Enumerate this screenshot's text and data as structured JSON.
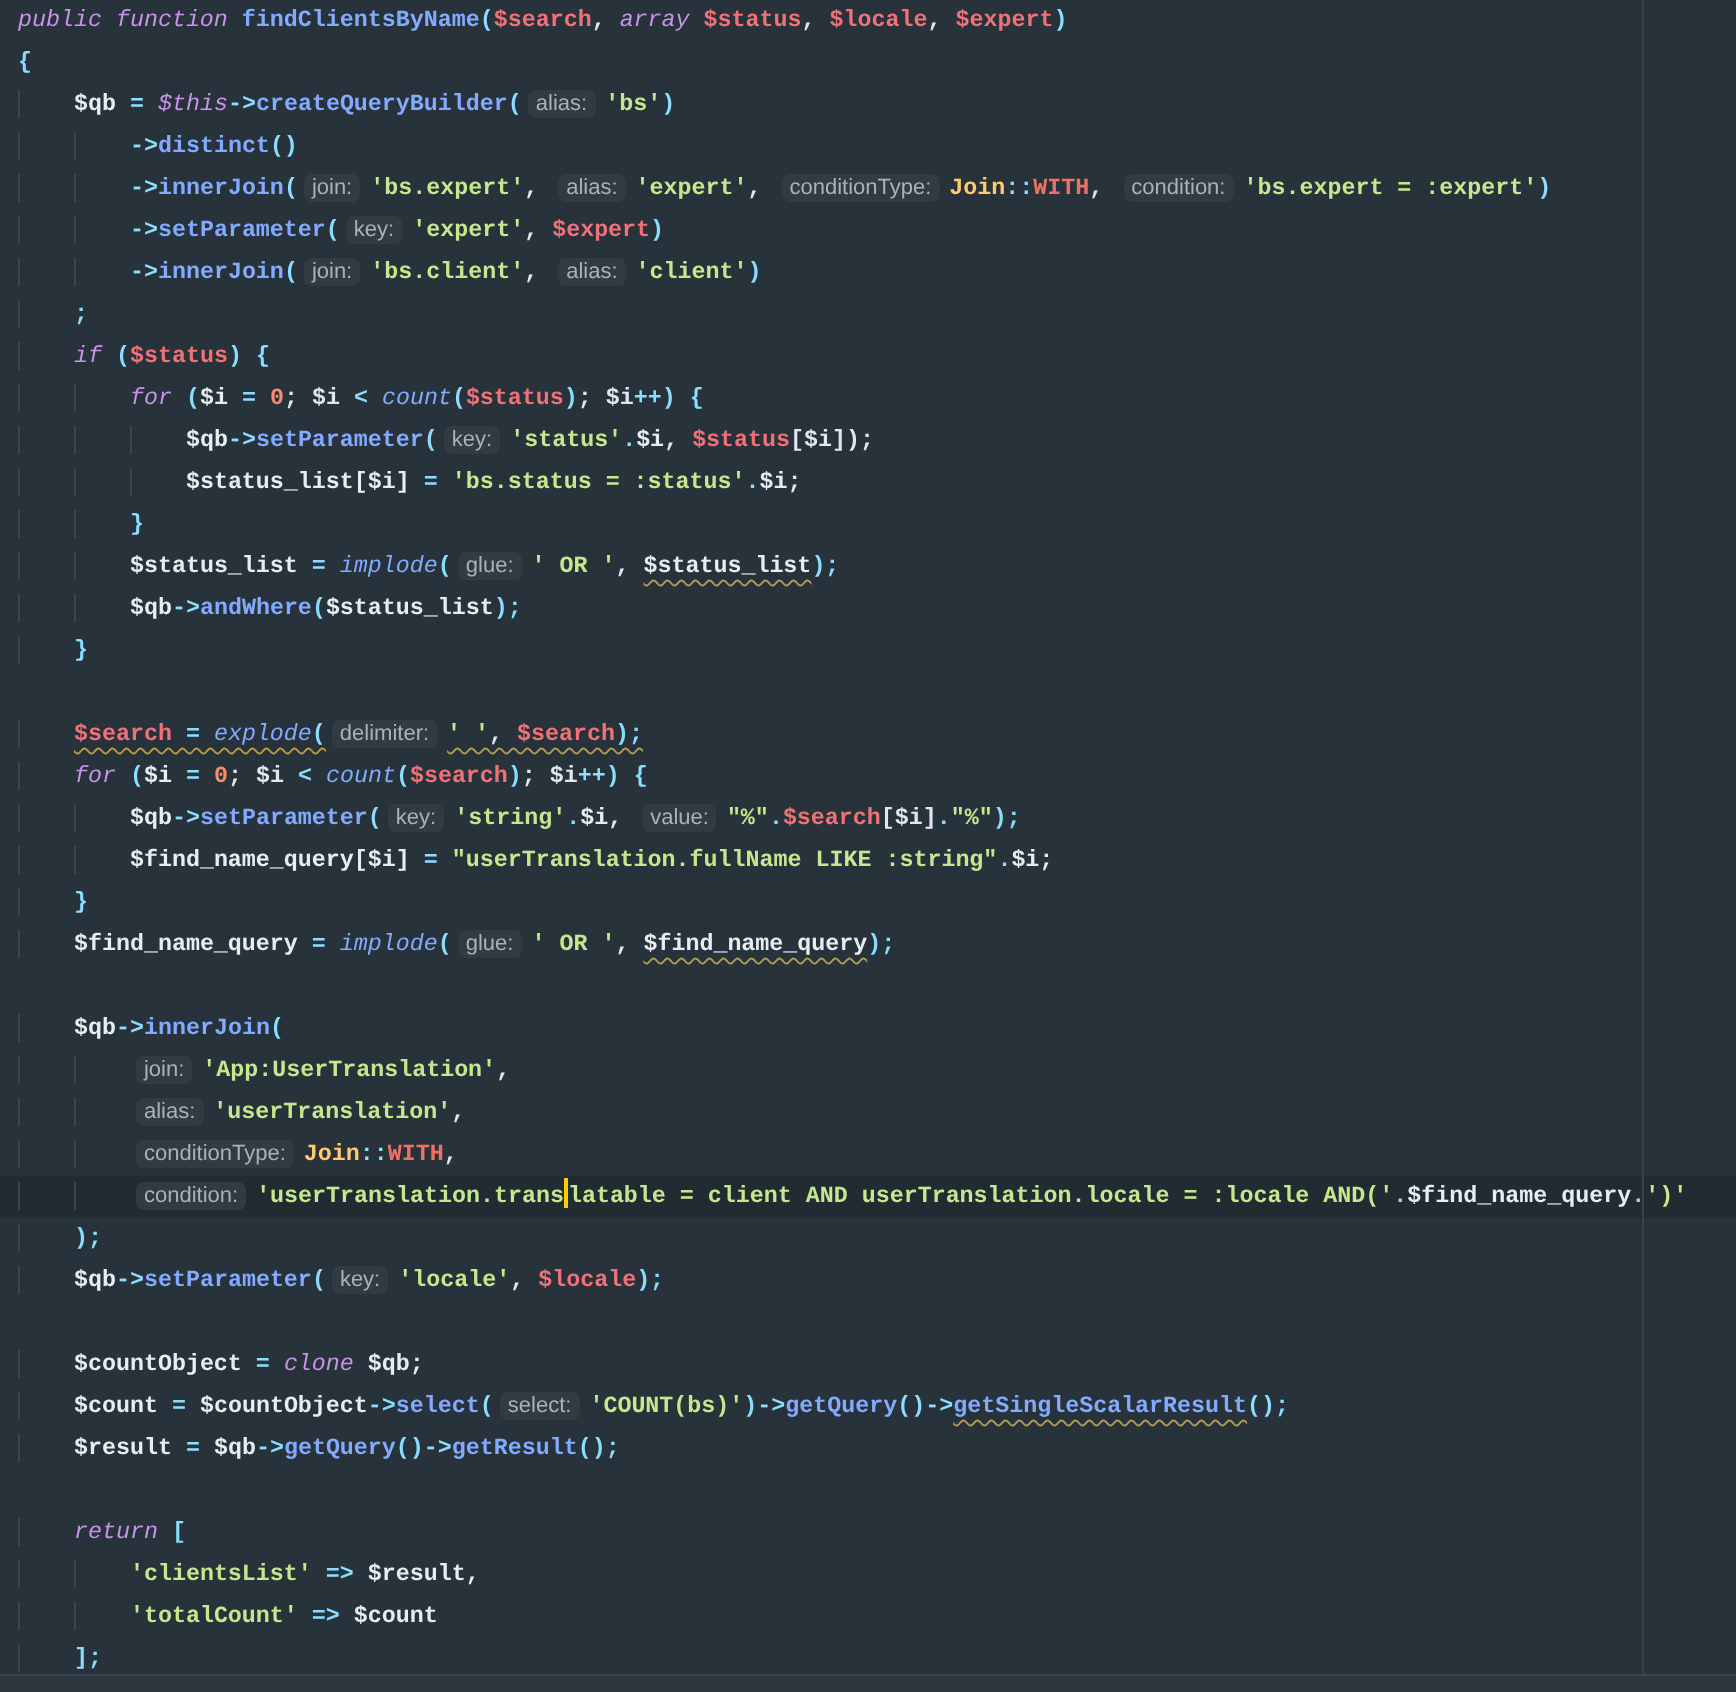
{
  "editor": {
    "lines": [
      {
        "kind": "code",
        "tokens": [
          {
            "kind": "kw",
            "text": "public function "
          },
          {
            "kind": "fn",
            "text": "findClientsByName"
          },
          {
            "kind": "punc",
            "text": "("
          },
          {
            "kind": "param",
            "text": "$search"
          },
          {
            "kind": "plain",
            "text": ", "
          },
          {
            "kind": "kw",
            "text": "array "
          },
          {
            "kind": "param",
            "text": "$status"
          },
          {
            "kind": "plain",
            "text": ", "
          },
          {
            "kind": "param",
            "text": "$locale"
          },
          {
            "kind": "plain",
            "text": ", "
          },
          {
            "kind": "param",
            "text": "$expert"
          },
          {
            "kind": "punc",
            "text": ")"
          }
        ]
      },
      {
        "kind": "code",
        "tokens": [
          {
            "kind": "punc",
            "text": "{"
          }
        ]
      },
      {
        "kind": "code",
        "tokens": [
          {
            "kind": "var",
            "text": "    $qb"
          },
          {
            "kind": "op",
            "text": " = "
          },
          {
            "kind": "kw",
            "text": "$this"
          },
          {
            "kind": "op",
            "text": "->"
          },
          {
            "kind": "fn",
            "text": "createQueryBuilder"
          },
          {
            "kind": "punc",
            "text": "("
          },
          {
            "kind": "hint",
            "text": "alias:"
          },
          {
            "kind": "str",
            "text": "'bs'"
          },
          {
            "kind": "punc",
            "text": ")"
          }
        ]
      },
      {
        "kind": "code",
        "tokens": [
          {
            "kind": "op",
            "text": "        ->"
          },
          {
            "kind": "fn",
            "text": "distinct"
          },
          {
            "kind": "punc",
            "text": "()"
          }
        ]
      },
      {
        "kind": "code",
        "tokens": [
          {
            "kind": "op",
            "text": "        ->"
          },
          {
            "kind": "fn",
            "text": "innerJoin"
          },
          {
            "kind": "punc",
            "text": "("
          },
          {
            "kind": "hint",
            "text": "join:"
          },
          {
            "kind": "str",
            "text": "'bs.expert'"
          },
          {
            "kind": "plain",
            "text": ", "
          },
          {
            "kind": "hint",
            "text": "alias:"
          },
          {
            "kind": "str",
            "text": "'expert'"
          },
          {
            "kind": "plain",
            "text": ", "
          },
          {
            "kind": "hint",
            "text": "conditionType:"
          },
          {
            "kind": "cls",
            "text": "Join"
          },
          {
            "kind": "op",
            "text": "::"
          },
          {
            "kind": "const",
            "text": "WITH"
          },
          {
            "kind": "plain",
            "text": ", "
          },
          {
            "kind": "hint",
            "text": "condition:"
          },
          {
            "kind": "str",
            "text": "'bs.expert = :expert'"
          },
          {
            "kind": "punc",
            "text": ")"
          }
        ]
      },
      {
        "kind": "code",
        "tokens": [
          {
            "kind": "op",
            "text": "        ->"
          },
          {
            "kind": "fn",
            "text": "setParameter"
          },
          {
            "kind": "punc",
            "text": "("
          },
          {
            "kind": "hint",
            "text": "key:"
          },
          {
            "kind": "str",
            "text": "'expert'"
          },
          {
            "kind": "plain",
            "text": ", "
          },
          {
            "kind": "param",
            "text": "$expert"
          },
          {
            "kind": "punc",
            "text": ")"
          }
        ]
      },
      {
        "kind": "code",
        "tokens": [
          {
            "kind": "op",
            "text": "        ->"
          },
          {
            "kind": "fn",
            "text": "innerJoin"
          },
          {
            "kind": "punc",
            "text": "("
          },
          {
            "kind": "hint",
            "text": "join:"
          },
          {
            "kind": "str",
            "text": "'bs.client'"
          },
          {
            "kind": "plain",
            "text": ", "
          },
          {
            "kind": "hint",
            "text": "alias:"
          },
          {
            "kind": "str",
            "text": "'client'"
          },
          {
            "kind": "punc",
            "text": ")"
          }
        ]
      },
      {
        "kind": "code",
        "tokens": [
          {
            "kind": "punc",
            "text": "    ;"
          }
        ]
      },
      {
        "kind": "code",
        "tokens": [
          {
            "kind": "kw",
            "text": "    if"
          },
          {
            "kind": "punc",
            "text": " ("
          },
          {
            "kind": "param",
            "text": "$status"
          },
          {
            "kind": "punc",
            "text": ") {"
          }
        ]
      },
      {
        "kind": "code",
        "tokens": [
          {
            "kind": "kw",
            "text": "        for"
          },
          {
            "kind": "punc",
            "text": " ("
          },
          {
            "kind": "var",
            "text": "$i"
          },
          {
            "kind": "op",
            "text": " = "
          },
          {
            "kind": "num",
            "text": "0"
          },
          {
            "kind": "plain",
            "text": "; $i"
          },
          {
            "kind": "op",
            "text": " < "
          },
          {
            "kind": "builtin",
            "text": "count"
          },
          {
            "kind": "punc",
            "text": "("
          },
          {
            "kind": "param",
            "text": "$status"
          },
          {
            "kind": "punc",
            "text": ")"
          },
          {
            "kind": "plain",
            "text": "; $i"
          },
          {
            "kind": "op",
            "text": "++"
          },
          {
            "kind": "punc",
            "text": ") {"
          }
        ]
      },
      {
        "kind": "code",
        "tokens": [
          {
            "kind": "var",
            "text": "            $qb"
          },
          {
            "kind": "op",
            "text": "->"
          },
          {
            "kind": "fn",
            "text": "setParameter"
          },
          {
            "kind": "punc",
            "text": "("
          },
          {
            "kind": "hint",
            "text": "key:"
          },
          {
            "kind": "str",
            "text": "'status'"
          },
          {
            "kind": "op",
            "text": "."
          },
          {
            "kind": "var",
            "text": "$i"
          },
          {
            "kind": "plain",
            "text": ", "
          },
          {
            "kind": "param",
            "text": "$status"
          },
          {
            "kind": "plain",
            "text": "[$i]);"
          }
        ]
      },
      {
        "kind": "code",
        "tokens": [
          {
            "kind": "var",
            "text": "            $status_list[$i]"
          },
          {
            "kind": "op",
            "text": " = "
          },
          {
            "kind": "str",
            "text": "'bs.status = :status'"
          },
          {
            "kind": "op",
            "text": "."
          },
          {
            "kind": "var",
            "text": "$i;"
          }
        ]
      },
      {
        "kind": "code",
        "tokens": [
          {
            "kind": "punc",
            "text": "        }"
          }
        ]
      },
      {
        "kind": "code",
        "tokens": [
          {
            "kind": "var",
            "text": "        $status_list"
          },
          {
            "kind": "op",
            "text": " = "
          },
          {
            "kind": "builtin",
            "text": "implode"
          },
          {
            "kind": "punc",
            "text": "("
          },
          {
            "kind": "hint",
            "text": "glue:"
          },
          {
            "kind": "str",
            "text": "' OR '"
          },
          {
            "kind": "plain",
            "text": ", "
          },
          {
            "kind": "var",
            "text": "$status_list",
            "warning": true
          },
          {
            "kind": "punc",
            "text": ");"
          }
        ]
      },
      {
        "kind": "code",
        "tokens": [
          {
            "kind": "var",
            "text": "        $qb"
          },
          {
            "kind": "op",
            "text": "->"
          },
          {
            "kind": "fn",
            "text": "andWhere"
          },
          {
            "kind": "punc",
            "text": "("
          },
          {
            "kind": "var",
            "text": "$status_list"
          },
          {
            "kind": "punc",
            "text": ");"
          }
        ]
      },
      {
        "kind": "code",
        "tokens": [
          {
            "kind": "punc",
            "text": "    }"
          }
        ]
      },
      {
        "kind": "blank"
      },
      {
        "kind": "code",
        "tokens": [
          {
            "kind": "param",
            "text": "    $search",
            "warning": true
          },
          {
            "kind": "op",
            "text": " = ",
            "warning": true
          },
          {
            "kind": "builtin",
            "text": "explode",
            "warning": true
          },
          {
            "kind": "punc",
            "text": "(",
            "warning": true
          },
          {
            "kind": "hint",
            "text": "delimiter:"
          },
          {
            "kind": "str",
            "text": "' '",
            "warning": true
          },
          {
            "kind": "plain",
            "text": ", ",
            "warning": true
          },
          {
            "kind": "param",
            "text": "$search",
            "warning": true
          },
          {
            "kind": "punc",
            "text": ");",
            "warning": true
          }
        ]
      },
      {
        "kind": "code",
        "tokens": [
          {
            "kind": "kw",
            "text": "    for"
          },
          {
            "kind": "punc",
            "text": " ("
          },
          {
            "kind": "var",
            "text": "$i"
          },
          {
            "kind": "op",
            "text": " = "
          },
          {
            "kind": "num",
            "text": "0"
          },
          {
            "kind": "plain",
            "text": "; $i"
          },
          {
            "kind": "op",
            "text": " < "
          },
          {
            "kind": "builtin",
            "text": "count"
          },
          {
            "kind": "punc",
            "text": "("
          },
          {
            "kind": "param",
            "text": "$search"
          },
          {
            "kind": "punc",
            "text": ")"
          },
          {
            "kind": "plain",
            "text": "; $i"
          },
          {
            "kind": "op",
            "text": "++"
          },
          {
            "kind": "punc",
            "text": ") {"
          }
        ]
      },
      {
        "kind": "code",
        "tokens": [
          {
            "kind": "var",
            "text": "        $qb"
          },
          {
            "kind": "op",
            "text": "->"
          },
          {
            "kind": "fn",
            "text": "setParameter"
          },
          {
            "kind": "punc",
            "text": "("
          },
          {
            "kind": "hint",
            "text": "key:"
          },
          {
            "kind": "str",
            "text": "'string'"
          },
          {
            "kind": "op",
            "text": "."
          },
          {
            "kind": "var",
            "text": "$i"
          },
          {
            "kind": "plain",
            "text": ", "
          },
          {
            "kind": "hint",
            "text": "value:"
          },
          {
            "kind": "str",
            "text": "\"%\""
          },
          {
            "kind": "op",
            "text": "."
          },
          {
            "kind": "param",
            "text": "$search"
          },
          {
            "kind": "plain",
            "text": "[$i]"
          },
          {
            "kind": "op",
            "text": "."
          },
          {
            "kind": "str",
            "text": "\"%\""
          },
          {
            "kind": "punc",
            "text": ");"
          }
        ]
      },
      {
        "kind": "code",
        "tokens": [
          {
            "kind": "var",
            "text": "        $find_name_query[$i]"
          },
          {
            "kind": "op",
            "text": " = "
          },
          {
            "kind": "str",
            "text": "\"userTranslation.fullName LIKE :string\""
          },
          {
            "kind": "op",
            "text": "."
          },
          {
            "kind": "var",
            "text": "$i;"
          }
        ]
      },
      {
        "kind": "code",
        "tokens": [
          {
            "kind": "punc",
            "text": "    }"
          }
        ]
      },
      {
        "kind": "code",
        "tokens": [
          {
            "kind": "var",
            "text": "    $find_name_query"
          },
          {
            "kind": "op",
            "text": " = "
          },
          {
            "kind": "builtin",
            "text": "implode"
          },
          {
            "kind": "punc",
            "text": "("
          },
          {
            "kind": "hint",
            "text": "glue:"
          },
          {
            "kind": "str",
            "text": "' OR '"
          },
          {
            "kind": "plain",
            "text": ", "
          },
          {
            "kind": "var",
            "text": "$find_name_query",
            "warning": true
          },
          {
            "kind": "punc",
            "text": ");"
          }
        ]
      },
      {
        "kind": "blank"
      },
      {
        "kind": "code",
        "tokens": [
          {
            "kind": "var",
            "text": "    $qb"
          },
          {
            "kind": "op",
            "text": "->"
          },
          {
            "kind": "fn",
            "text": "innerJoin"
          },
          {
            "kind": "punc",
            "text": "("
          }
        ]
      },
      {
        "kind": "code",
        "tokens": [
          {
            "kind": "hint",
            "text": "        join:"
          },
          {
            "kind": "str",
            "text": "'App:UserTranslation'"
          },
          {
            "kind": "plain",
            "text": ","
          }
        ]
      },
      {
        "kind": "code",
        "tokens": [
          {
            "kind": "hint",
            "text": "        alias:"
          },
          {
            "kind": "str",
            "text": "'userTranslation'"
          },
          {
            "kind": "plain",
            "text": ","
          }
        ]
      },
      {
        "kind": "code",
        "tokens": [
          {
            "kind": "hint",
            "text": "        conditionType:"
          },
          {
            "kind": "cls",
            "text": "Join"
          },
          {
            "kind": "op",
            "text": "::"
          },
          {
            "kind": "const",
            "text": "WITH"
          },
          {
            "kind": "plain",
            "text": ","
          }
        ]
      },
      {
        "kind": "code",
        "current": true,
        "tokens": [
          {
            "kind": "hint",
            "text": "        condition:"
          },
          {
            "kind": "str",
            "text": "'userTranslation.trans",
            "caret": true
          },
          {
            "kind": "str",
            "text": "latable = client AND userTranslation.locale = :locale AND('"
          },
          {
            "kind": "op",
            "text": "."
          },
          {
            "kind": "var",
            "text": "$find_name_query"
          },
          {
            "kind": "op",
            "text": "."
          },
          {
            "kind": "str",
            "text": "')'"
          }
        ]
      },
      {
        "kind": "code",
        "tokens": [
          {
            "kind": "punc",
            "text": "    );"
          }
        ]
      },
      {
        "kind": "code",
        "tokens": [
          {
            "kind": "var",
            "text": "    $qb"
          },
          {
            "kind": "op",
            "text": "->"
          },
          {
            "kind": "fn",
            "text": "setParameter"
          },
          {
            "kind": "punc",
            "text": "("
          },
          {
            "kind": "hint",
            "text": "key:"
          },
          {
            "kind": "str",
            "text": "'locale'"
          },
          {
            "kind": "plain",
            "text": ", "
          },
          {
            "kind": "param",
            "text": "$locale"
          },
          {
            "kind": "punc",
            "text": ");"
          }
        ]
      },
      {
        "kind": "blank"
      },
      {
        "kind": "code",
        "tokens": [
          {
            "kind": "var",
            "text": "    $countObject"
          },
          {
            "kind": "op",
            "text": " = "
          },
          {
            "kind": "kw",
            "text": "clone "
          },
          {
            "kind": "var",
            "text": "$qb;"
          }
        ]
      },
      {
        "kind": "code",
        "tokens": [
          {
            "kind": "var",
            "text": "    $count"
          },
          {
            "kind": "op",
            "text": " = "
          },
          {
            "kind": "var",
            "text": "$countObject"
          },
          {
            "kind": "op",
            "text": "->"
          },
          {
            "kind": "fn",
            "text": "select"
          },
          {
            "kind": "punc",
            "text": "("
          },
          {
            "kind": "hint",
            "text": "select:"
          },
          {
            "kind": "str",
            "text": "'COUNT(bs)'"
          },
          {
            "kind": "punc",
            "text": ")"
          },
          {
            "kind": "op",
            "text": "->"
          },
          {
            "kind": "fn",
            "text": "getQuery"
          },
          {
            "kind": "punc",
            "text": "()"
          },
          {
            "kind": "op",
            "text": "->"
          },
          {
            "kind": "fn",
            "text": "getSingleScalarResult",
            "warning": true
          },
          {
            "kind": "punc",
            "text": "();"
          }
        ]
      },
      {
        "kind": "code",
        "tokens": [
          {
            "kind": "var",
            "text": "    $result"
          },
          {
            "kind": "op",
            "text": " = "
          },
          {
            "kind": "var",
            "text": "$qb"
          },
          {
            "kind": "op",
            "text": "->"
          },
          {
            "kind": "fn",
            "text": "getQuery"
          },
          {
            "kind": "punc",
            "text": "()"
          },
          {
            "kind": "op",
            "text": "->"
          },
          {
            "kind": "fn",
            "text": "getResult"
          },
          {
            "kind": "punc",
            "text": "();"
          }
        ]
      },
      {
        "kind": "blank"
      },
      {
        "kind": "code",
        "tokens": [
          {
            "kind": "kw",
            "text": "    return"
          },
          {
            "kind": "punc",
            "text": " ["
          }
        ]
      },
      {
        "kind": "code",
        "tokens": [
          {
            "kind": "str",
            "text": "        'clientsList'"
          },
          {
            "kind": "op",
            "text": " => "
          },
          {
            "kind": "var",
            "text": "$result,"
          }
        ]
      },
      {
        "kind": "code",
        "tokens": [
          {
            "kind": "str",
            "text": "        'totalCount'"
          },
          {
            "kind": "op",
            "text": " => "
          },
          {
            "kind": "var",
            "text": "$count"
          }
        ]
      },
      {
        "kind": "code",
        "tokens": [
          {
            "kind": "punc",
            "text": "    ];"
          }
        ]
      }
    ]
  }
}
